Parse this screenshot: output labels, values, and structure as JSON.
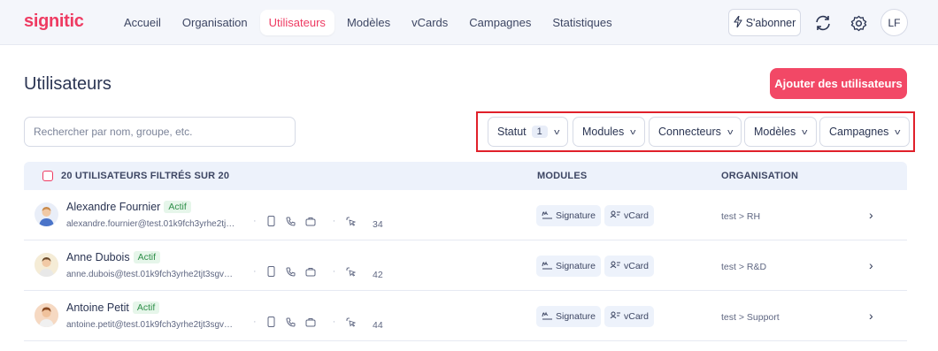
{
  "brand": {
    "logo": "signitic",
    "accent": "#ee3b62"
  },
  "nav": {
    "items": [
      {
        "label": "Accueil",
        "active": false
      },
      {
        "label": "Organisation",
        "active": false
      },
      {
        "label": "Utilisateurs",
        "active": true
      },
      {
        "label": "Modèles",
        "active": false
      },
      {
        "label": "vCards",
        "active": false
      },
      {
        "label": "Campagnes",
        "active": false
      },
      {
        "label": "Statistiques",
        "active": false
      }
    ],
    "subscribe_label": "S'abonner",
    "user_initials": "LF"
  },
  "page": {
    "title": "Utilisateurs",
    "add_button": "Ajouter des utilisateurs"
  },
  "search": {
    "placeholder": "Rechercher par nom, groupe, etc."
  },
  "filters": {
    "statut": {
      "label": "Statut",
      "count": "1"
    },
    "modules": "Modules",
    "connecteurs": "Connecteurs",
    "modeles": "Modèles",
    "campagnes": "Campagnes"
  },
  "table": {
    "header_count": "20 UTILISATEURS FILTRÉS SUR 20",
    "col_modules": "MODULES",
    "col_org": "ORGANISATION",
    "rows": [
      {
        "name": "Alexandre Fournier",
        "status": "Actif",
        "email": "alexandre.fournier@test.01k9fch3yrhe2tjt3sgvgjt8zp.local",
        "count": "34",
        "module1": "Signature",
        "module2": "vCard",
        "org": "test > RH"
      },
      {
        "name": "Anne Dubois",
        "status": "Actif",
        "email": "anne.dubois@test.01k9fch3yrhe2tjt3sgvgjt8zp.local",
        "count": "42",
        "module1": "Signature",
        "module2": "vCard",
        "org": "test > R&D"
      },
      {
        "name": "Antoine Petit",
        "status": "Actif",
        "email": "antoine.petit@test.01k9fch3yrhe2tjt3sgvgjt8zp.local",
        "count": "44",
        "module1": "Signature",
        "module2": "vCard",
        "org": "test > Support"
      }
    ]
  }
}
